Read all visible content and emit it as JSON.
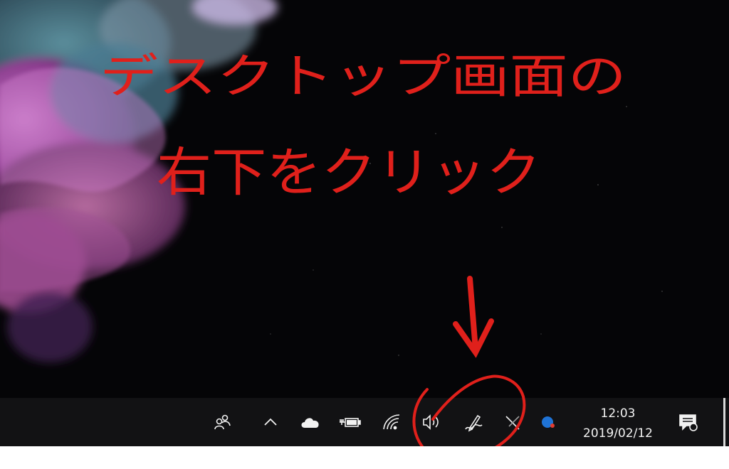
{
  "annotation": {
    "line1": "デスクトップ画面の",
    "line2": "右下をクリック",
    "color": "#e0201b"
  },
  "taskbar": {
    "tray_icons": [
      {
        "name": "people-icon"
      },
      {
        "name": "chevron-up-icon"
      },
      {
        "name": "onedrive-cloud-icon"
      },
      {
        "name": "battery-plug-icon"
      },
      {
        "name": "wifi-icon"
      },
      {
        "name": "volume-icon"
      },
      {
        "name": "pen-workspace-icon"
      },
      {
        "name": "pen-off-icon"
      },
      {
        "name": "assistant-dot-icon"
      }
    ],
    "clock": {
      "time": "12:03",
      "date": "2019/02/12"
    },
    "background": "#121214",
    "text_color": "#f2f2f2"
  }
}
